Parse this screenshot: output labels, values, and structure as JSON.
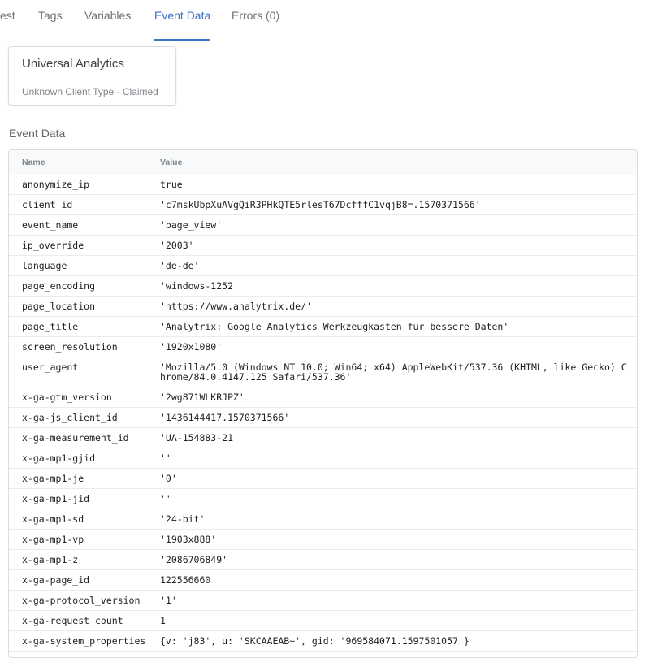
{
  "tabs": [
    {
      "label": "est",
      "active": false
    },
    {
      "label": "Tags",
      "active": false
    },
    {
      "label": "Variables",
      "active": false
    },
    {
      "label": "Event Data",
      "active": true
    },
    {
      "label": "Errors (0)",
      "active": false
    }
  ],
  "client": {
    "name": "Universal Analytics",
    "type": "Unknown Client Type - Claimed"
  },
  "section_title": "Event Data",
  "table": {
    "headers": {
      "name": "Name",
      "value": "Value"
    },
    "rows": [
      {
        "name": "anonymize_ip",
        "value": "true"
      },
      {
        "name": "client_id",
        "value": "'c7mskUbpXuAVgQiR3PHkQTE5rlesT67DcfffC1vqjB8=.1570371566'"
      },
      {
        "name": "event_name",
        "value": "'page_view'"
      },
      {
        "name": "ip_override",
        "value": "'2003'"
      },
      {
        "name": "language",
        "value": "'de-de'"
      },
      {
        "name": "page_encoding",
        "value": "'windows-1252'"
      },
      {
        "name": "page_location",
        "value": "'https://www.analytrix.de/'"
      },
      {
        "name": "page_title",
        "value": "'Analytrix: Google Analytics Werkzeugkasten für bessere Daten'"
      },
      {
        "name": "screen_resolution",
        "value": "'1920x1080'"
      },
      {
        "name": "user_agent",
        "value": "'Mozilla/5.0 (Windows NT 10.0; Win64; x64) AppleWebKit/537.36 (KHTML, like Gecko) Chrome/84.0.4147.125 Safari/537.36'"
      },
      {
        "name": "x-ga-gtm_version",
        "value": "'2wg871WLKRJPZ'"
      },
      {
        "name": "x-ga-js_client_id",
        "value": "'1436144417.1570371566'"
      },
      {
        "name": "x-ga-measurement_id",
        "value": "'UA-154883-21'"
      },
      {
        "name": "x-ga-mp1-gjid",
        "value": "''"
      },
      {
        "name": "x-ga-mp1-je",
        "value": "'0'"
      },
      {
        "name": "x-ga-mp1-jid",
        "value": "''"
      },
      {
        "name": "x-ga-mp1-sd",
        "value": "'24-bit'"
      },
      {
        "name": "x-ga-mp1-vp",
        "value": "'1903x888'"
      },
      {
        "name": "x-ga-mp1-z",
        "value": "'2086706849'"
      },
      {
        "name": "x-ga-page_id",
        "value": "122556660"
      },
      {
        "name": "x-ga-protocol_version",
        "value": "'1'"
      },
      {
        "name": "x-ga-request_count",
        "value": "1"
      },
      {
        "name": "x-ga-system_properties",
        "value": "{v: 'j83', u: 'SKCAAEAB~', gid: '969584071.1597501057'}"
      }
    ]
  }
}
